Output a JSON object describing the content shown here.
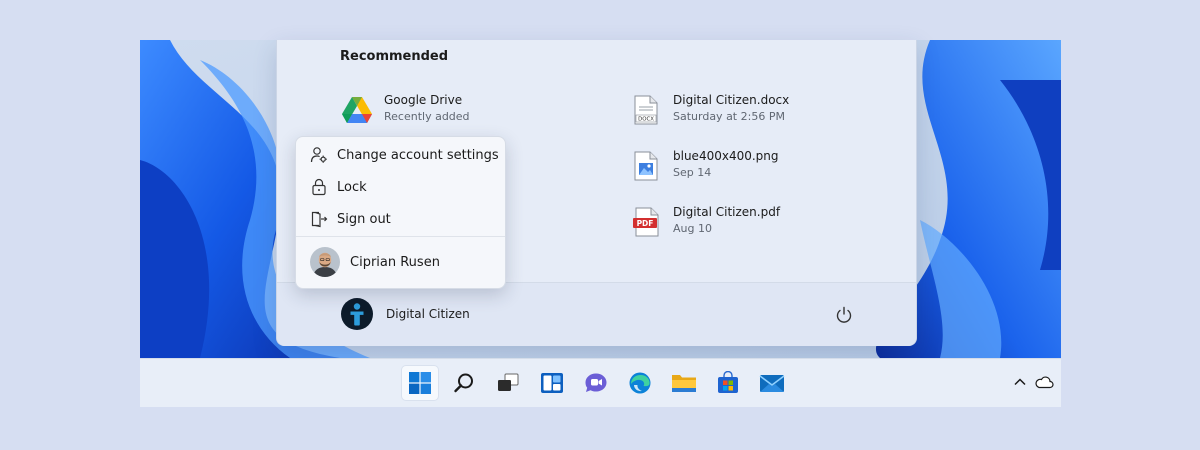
{
  "recommended": {
    "title": "Recommended",
    "items": [
      {
        "name": "Google Drive",
        "sub": "Recently added",
        "icon": "google-drive-icon"
      },
      {
        "name": "Digital Citizen.docx",
        "sub": "Saturday at 2:56 PM",
        "icon": "docx-file-icon",
        "badge": "DOCX"
      },
      {
        "name": "blue400x400.png",
        "sub": "Sep 14",
        "icon": "image-file-icon"
      },
      {
        "name": "Digital Citizen.pdf",
        "sub": "Aug 10",
        "icon": "pdf-file-icon",
        "badge": "PDF"
      }
    ]
  },
  "account_menu": {
    "items": [
      {
        "label": "Change account settings",
        "icon": "account-settings-icon"
      },
      {
        "label": "Lock",
        "icon": "lock-icon"
      },
      {
        "label": "Sign out",
        "icon": "sign-out-icon"
      }
    ],
    "other_user": "Ciprian Rusen"
  },
  "footer": {
    "user_name": "Digital Citizen",
    "power_icon": "power-icon"
  },
  "taskbar": {
    "icons": [
      "start-icon",
      "search-icon",
      "task-view-icon",
      "widgets-icon",
      "teams-chat-icon",
      "edge-icon",
      "file-explorer-icon",
      "store-icon",
      "mail-icon"
    ],
    "tray": [
      "chevron-up-icon",
      "onedrive-icon"
    ]
  },
  "colors": {
    "accent": "#0067c0",
    "pdf_red": "#d32f2f",
    "wallpaper_blue": "#1a5fe0"
  }
}
